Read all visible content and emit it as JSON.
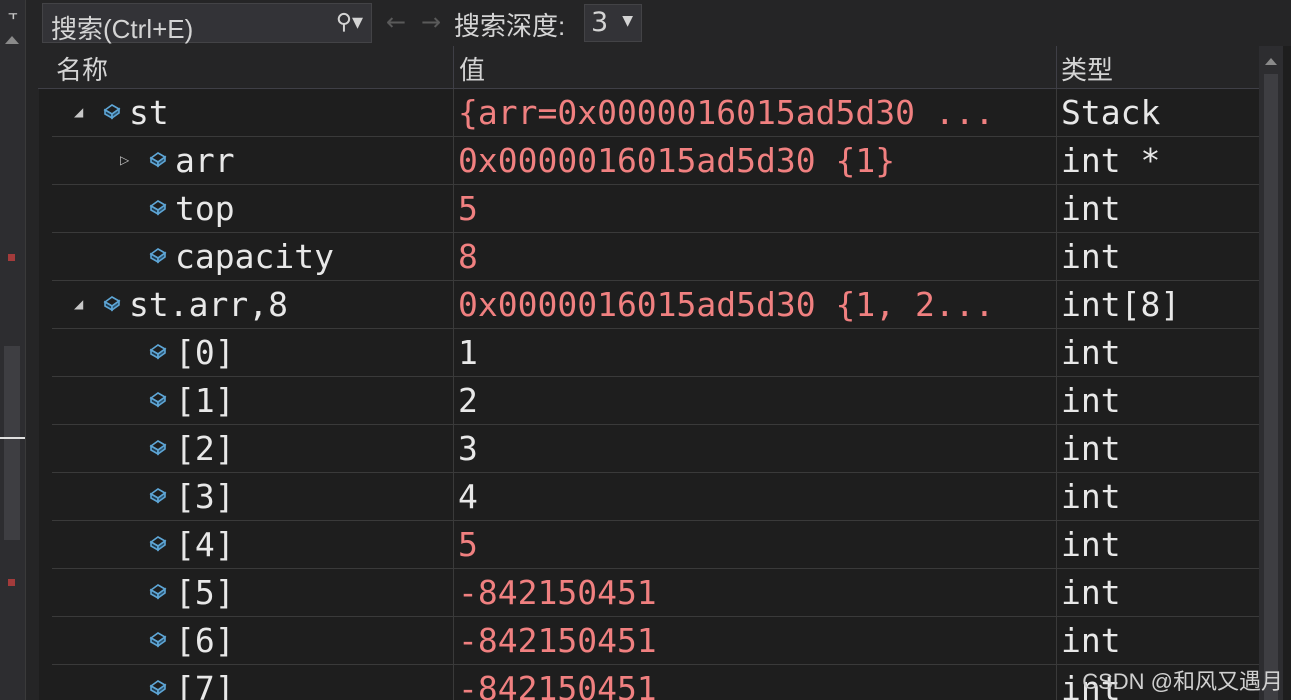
{
  "toolbar": {
    "search_placeholder": "搜索(Ctrl+E)",
    "depth_label": "搜索深度:",
    "depth_value": "3",
    "back_glyph": "←",
    "forward_glyph": "→"
  },
  "columns": {
    "name": "名称",
    "value": "值",
    "type": "类型"
  },
  "rows": [
    {
      "name": "st",
      "value": "{arr=0x0000016015ad5d30 ...",
      "type": "Stack",
      "level": 0,
      "expander": "expanded",
      "value_color": "red"
    },
    {
      "name": "arr",
      "value": "0x0000016015ad5d30 {1}",
      "type": "int *",
      "level": 1,
      "expander": "collapsed",
      "value_color": "red"
    },
    {
      "name": "top",
      "value": "5",
      "type": "int",
      "level": 1,
      "expander": "none",
      "value_color": "red"
    },
    {
      "name": "capacity",
      "value": "8",
      "type": "int",
      "level": 1,
      "expander": "none",
      "value_color": "red"
    },
    {
      "name": "st.arr,8",
      "value": "0x0000016015ad5d30 {1, 2...",
      "type": "int[8]",
      "level": 0,
      "expander": "expanded",
      "value_color": "red"
    },
    {
      "name": "[0]",
      "value": "1",
      "type": "int",
      "level": 1,
      "expander": "none",
      "value_color": "white"
    },
    {
      "name": "[1]",
      "value": "2",
      "type": "int",
      "level": 1,
      "expander": "none",
      "value_color": "white"
    },
    {
      "name": "[2]",
      "value": "3",
      "type": "int",
      "level": 1,
      "expander": "none",
      "value_color": "white"
    },
    {
      "name": "[3]",
      "value": "4",
      "type": "int",
      "level": 1,
      "expander": "none",
      "value_color": "white"
    },
    {
      "name": "[4]",
      "value": "5",
      "type": "int",
      "level": 1,
      "expander": "none",
      "value_color": "red"
    },
    {
      "name": "[5]",
      "value": "-842150451",
      "type": "int",
      "level": 1,
      "expander": "none",
      "value_color": "red"
    },
    {
      "name": "[6]",
      "value": "-842150451",
      "type": "int",
      "level": 1,
      "expander": "none",
      "value_color": "red"
    },
    {
      "name": "[7]",
      "value": "-842150451",
      "type": "int",
      "level": 1,
      "expander": "none",
      "value_color": "red"
    }
  ],
  "watermark": "CSDN @和风又遇月",
  "colors": {
    "background": "#1e1e1e",
    "changed_value": "#f08080",
    "normal_value": "#e8e8e8",
    "icon_blue": "#5ea6d6"
  },
  "icons": {
    "search": "search-icon",
    "object": "object-cube-icon",
    "expanded": "triangle-expanded-icon",
    "collapsed": "triangle-collapsed-icon"
  }
}
